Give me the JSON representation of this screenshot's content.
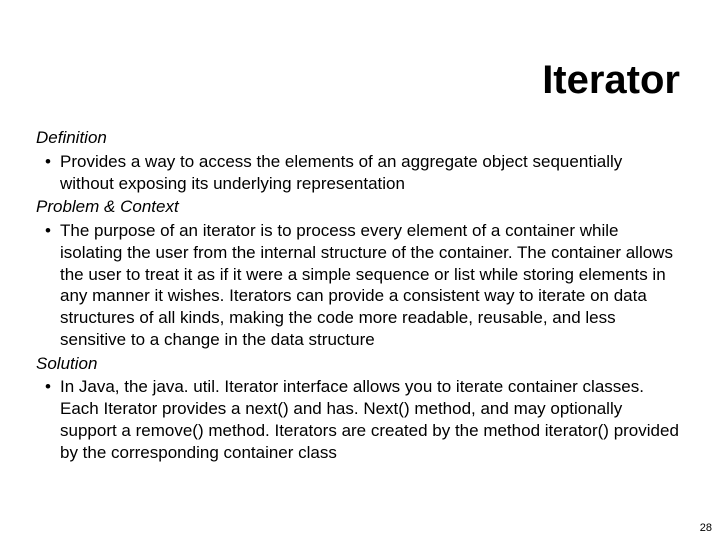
{
  "title": "Iterator",
  "sections": {
    "definition": {
      "heading": "Definition",
      "bullet": "Provides a way to access the elements of an aggregate object sequentially without exposing its underlying representation"
    },
    "problem": {
      "heading": "Problem & Context",
      "bullet": "The purpose of an iterator is to process every element of a container while isolating the user from the internal structure of the container. The container allows the user to treat it as if it were a simple sequence or list while storing elements in any manner it wishes. Iterators can provide a consistent way to iterate on data structures of all kinds, making the code more readable, reusable, and less sensitive to a change in the data structure"
    },
    "solution": {
      "heading": "Solution",
      "bullet": "In Java, the java. util. Iterator interface allows you to iterate container classes. Each Iterator provides a next() and has. Next() method, and may optionally support a remove() method. Iterators are created by the method iterator() provided by the corresponding container class"
    }
  },
  "page_number": "28"
}
